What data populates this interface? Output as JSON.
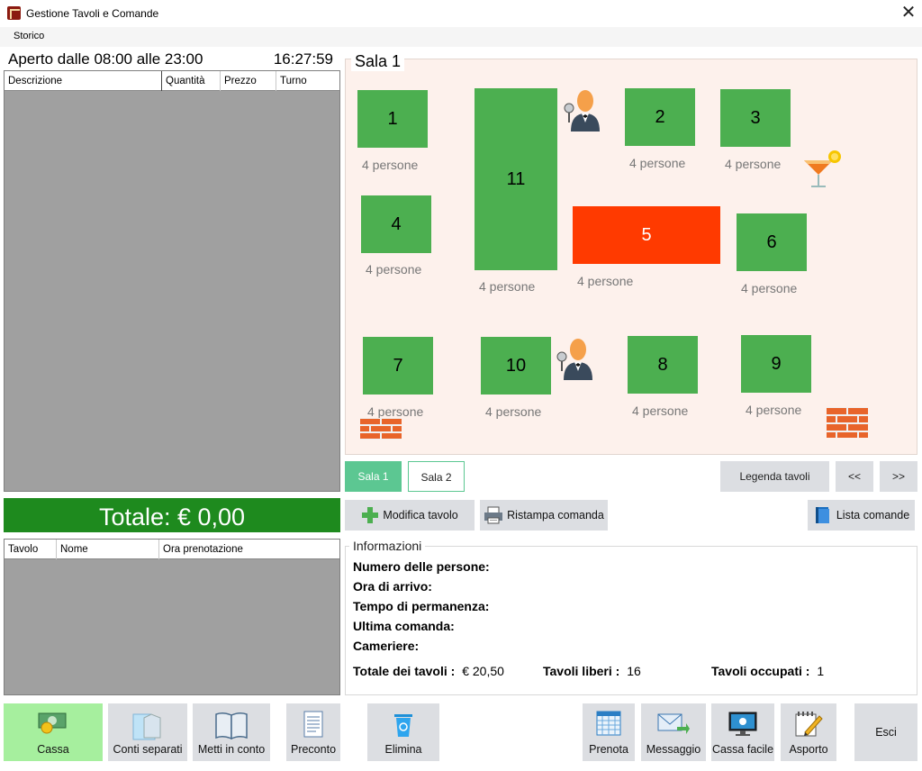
{
  "window": {
    "title": "Gestione Tavoli e Comande",
    "close_glyph": "✕"
  },
  "menu": {
    "storico": "Storico"
  },
  "orders": {
    "open_hours": "Aperto dalle 08:00 alle 23:00",
    "clock": "16:27:59",
    "columns": [
      "Descrizione",
      "Quantità",
      "Prezzo",
      "Turno"
    ]
  },
  "totale": "Totale: € 0,00",
  "reservations": {
    "columns": [
      "Tavolo",
      "Nome",
      "Ora prenotazione"
    ]
  },
  "room": {
    "title": "Sala 1",
    "tables": [
      {
        "num": "1",
        "people": "4 persone",
        "status": "libero"
      },
      {
        "num": "2",
        "people": "4 persone",
        "status": "libero"
      },
      {
        "num": "3",
        "people": "4 persone",
        "status": "libero"
      },
      {
        "num": "4",
        "people": "4 persone",
        "status": "libero"
      },
      {
        "num": "5",
        "people": "4 persone",
        "status": "occupato"
      },
      {
        "num": "6",
        "people": "4 persone",
        "status": "libero"
      },
      {
        "num": "7",
        "people": "4 persone",
        "status": "libero"
      },
      {
        "num": "8",
        "people": "4 persone",
        "status": "libero"
      },
      {
        "num": "9",
        "people": "4 persone",
        "status": "libero"
      },
      {
        "num": "10",
        "people": "4 persone",
        "status": "libero"
      },
      {
        "num": "11",
        "people": "4 persone",
        "status": "libero"
      }
    ],
    "colors": {
      "free": "#4caf50",
      "busy": "#ff3a00",
      "room_bg": "#fdf1ec"
    }
  },
  "tabs": {
    "sala1": "Sala 1",
    "sala2": "Sala 2"
  },
  "nav": {
    "legend": "Legenda tavoli",
    "prev": "<<",
    "next": ">>"
  },
  "actions": {
    "modify": "Modifica tavolo",
    "reprint": "Ristampa comanda",
    "list": "Lista comande"
  },
  "info": {
    "title": "Informazioni",
    "people": "Numero delle persone:",
    "arrival": "Ora di arrivo:",
    "stay": "Tempo di permanenza:",
    "last_order": "Ultima comanda:",
    "waiter": "Cameriere:",
    "total_label": "Totale dei tavoli :",
    "total_value": "€ 20,50",
    "free_label": "Tavoli liberi :",
    "free_value": "16",
    "busy_label": "Tavoli occupati :",
    "busy_value": "1"
  },
  "bottom": {
    "cassa": "Cassa",
    "conti": "Conti separati",
    "metti": "Metti in conto",
    "preconto": "Preconto",
    "elimina": "Elimina",
    "prenota": "Prenota",
    "messaggio": "Messaggio",
    "cassa_facile": "Cassa facile",
    "asporto": "Asporto",
    "esci": "Esci"
  }
}
